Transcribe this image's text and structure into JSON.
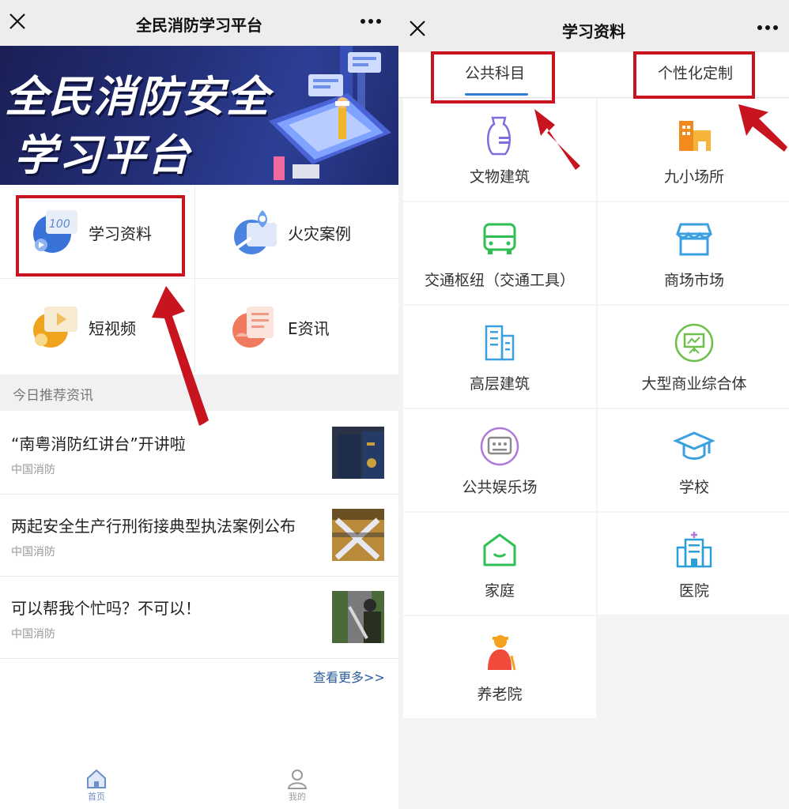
{
  "left": {
    "app_title": "全民消防学习平台",
    "banner": {
      "line1": "全民消防安全",
      "line2": "学习平台"
    },
    "menu": [
      {
        "label": "学习资料",
        "icon": "study-materials-icon"
      },
      {
        "label": "火灾案例",
        "icon": "fire-case-icon"
      },
      {
        "label": "短视频",
        "icon": "short-video-icon"
      },
      {
        "label": "E资讯",
        "icon": "e-news-icon"
      }
    ],
    "section_title": "今日推荐资讯",
    "news": [
      {
        "title": "“南粤消防红讲台”开讲啦",
        "source": "中国消防"
      },
      {
        "title": "两起安全生产行刑衔接典型执法案例公布",
        "source": "中国消防"
      },
      {
        "title": "可以帮我个忙吗？不可以！",
        "source": "中国消防"
      }
    ],
    "more_link": "查看更多>>",
    "tabbar": {
      "home": "首页",
      "mine": "我的"
    }
  },
  "right": {
    "page_title": "学习资料",
    "tabs": {
      "public": "公共科目",
      "custom": "个性化定制"
    },
    "categories": [
      {
        "label": "文物建筑",
        "icon": "vase-icon"
      },
      {
        "label": "九小场所",
        "icon": "small-shops-icon"
      },
      {
        "label": "交通枢纽（交通工具）",
        "icon": "bus-icon"
      },
      {
        "label": "商场市场",
        "icon": "store-icon"
      },
      {
        "label": "高层建筑",
        "icon": "high-rise-icon"
      },
      {
        "label": "大型商业综合体",
        "icon": "presentation-icon"
      },
      {
        "label": "公共娱乐场",
        "icon": "entertainment-icon"
      },
      {
        "label": "学校",
        "icon": "graduation-cap-icon"
      },
      {
        "label": "家庭",
        "icon": "home-icon"
      },
      {
        "label": "医院",
        "icon": "hospital-icon"
      },
      {
        "label": "养老院",
        "icon": "elderly-person-icon"
      }
    ]
  },
  "colors": {
    "annotation_red": "#c8141e",
    "tab_blue": "#2f7bd6",
    "link_blue": "#2b5c9e"
  }
}
